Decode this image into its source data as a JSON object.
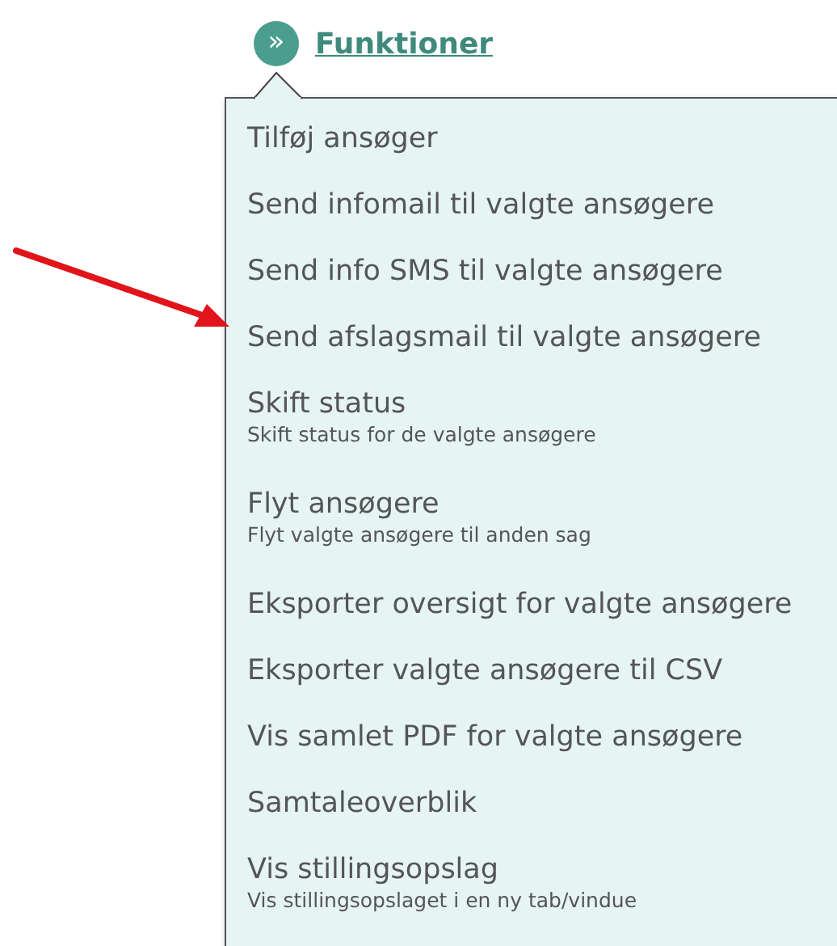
{
  "header": {
    "title": "Funktioner",
    "icon": "»"
  },
  "menu": {
    "items": [
      {
        "label": "Tilføj ansøger"
      },
      {
        "label": "Send infomail til valgte ansøgere"
      },
      {
        "label": "Send info SMS til valgte ansøgere"
      },
      {
        "label": "Send afslagsmail til valgte ansøgere"
      },
      {
        "label": "Skift status",
        "description": "Skift status for de valgte ansøgere"
      },
      {
        "label": "Flyt ansøgere",
        "description": "Flyt valgte ansøgere til anden sag"
      },
      {
        "label": "Eksporter oversigt for valgte ansøgere"
      },
      {
        "label": "Eksporter valgte ansøgere til CSV"
      },
      {
        "label": "Vis samlet PDF for valgte ansøgere"
      },
      {
        "label": "Samtaleoverblik"
      },
      {
        "label": "Vis stillingsopslag",
        "description": "Vis stillingsopslaget i en ny tab/vindue"
      }
    ]
  }
}
